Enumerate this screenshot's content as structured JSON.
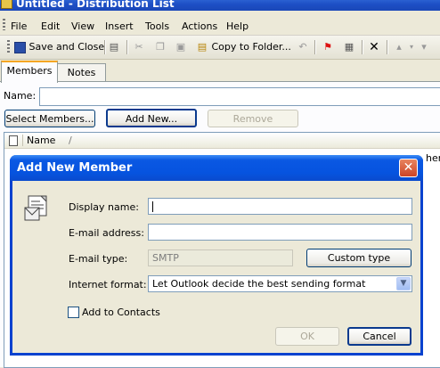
{
  "window": {
    "title": "Untitled - Distribution List"
  },
  "menu": [
    "File",
    "Edit",
    "View",
    "Insert",
    "Tools",
    "Actions",
    "Help"
  ],
  "toolbar": {
    "save_close": "Save and Close",
    "copy_to_folder": "Copy to Folder..."
  },
  "tabs": [
    "Members",
    "Notes"
  ],
  "form": {
    "name_label": "Name:",
    "name_value": "",
    "select_members": "Select Members...",
    "add_new": "Add New...",
    "remove": "Remove"
  },
  "list": {
    "column_name": "Name",
    "sort_indicator": "/",
    "cut_text": "here"
  },
  "dialog": {
    "title": "Add New Member",
    "close_glyph": "✕",
    "display_name_label": "Display name:",
    "display_name_value": "",
    "email_label": "E-mail address:",
    "email_value": "",
    "email_type_label": "E-mail type:",
    "email_type_value": "SMTP",
    "custom_type_button": "Custom type",
    "internet_format_label": "Internet format:",
    "internet_format_value": "Let Outlook decide the best sending format",
    "add_to_contacts_label": "Add to Contacts",
    "add_to_contacts_checked": false,
    "ok": "OK",
    "cancel": "Cancel"
  },
  "colors": {
    "dialog_title": "#0653df",
    "close_button": "#cc4427",
    "field_border": "#7f9db9"
  }
}
